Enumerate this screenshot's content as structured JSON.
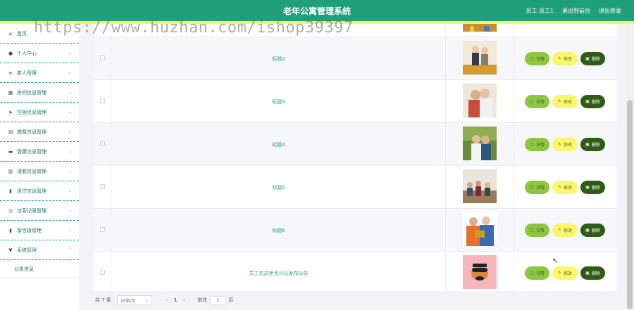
{
  "header": {
    "title": "老年公寓管理系统",
    "user": "员工 员工1",
    "to_front": "退出到前台",
    "logout": "退出登录"
  },
  "watermark": "https://www.huzhan.com/ishop39397",
  "sidebar": {
    "items": [
      {
        "label": "首页",
        "icon": "home-icon",
        "glyph": "⌂"
      },
      {
        "label": "个人中心",
        "icon": "user-icon",
        "glyph": "●"
      },
      {
        "label": "老人管理",
        "icon": "sliders-icon",
        "glyph": "≡"
      },
      {
        "label": "房间信息管理",
        "icon": "grid-icon",
        "glyph": "▦"
      },
      {
        "label": "住宿信息管理",
        "icon": "send-icon",
        "glyph": "➤"
      },
      {
        "label": "缴费信息管理",
        "icon": "card-icon",
        "glyph": "▤"
      },
      {
        "label": "健康信息管理",
        "icon": "box-icon",
        "glyph": "▬"
      },
      {
        "label": "请假信息管理",
        "icon": "list-icon",
        "glyph": "▥"
      },
      {
        "label": "退住信息管理",
        "icon": "building-icon",
        "glyph": "▮"
      },
      {
        "label": "访客记录管理",
        "icon": "compass-icon",
        "glyph": "◎"
      },
      {
        "label": "留言板管理",
        "icon": "chart-icon",
        "glyph": "▮"
      },
      {
        "label": "系统管理",
        "icon": "pin-icon",
        "glyph": "▼"
      }
    ],
    "sub_item": "公告信息"
  },
  "table": {
    "rows": [
      {
        "title": "标题2",
        "image": "elderly-couple-gold"
      },
      {
        "title": "标题3",
        "image": "elderly-couple-hug"
      },
      {
        "title": "标题4",
        "image": "elderly-couple-park"
      },
      {
        "title": "标题5",
        "image": "elderly-group-room"
      },
      {
        "title": "标题6",
        "image": "elderly-couple-gift"
      },
      {
        "title": "员工在这里也可以发布公告",
        "image": "cartoon-face"
      }
    ],
    "actions": {
      "detail": "详情",
      "edit": "修改",
      "delete": "删除"
    }
  },
  "pager": {
    "total": "共 7 条",
    "page_size": "10条/页",
    "current_page": "1",
    "goto_label": "前往",
    "goto_value": "1",
    "page_suffix": "页"
  }
}
